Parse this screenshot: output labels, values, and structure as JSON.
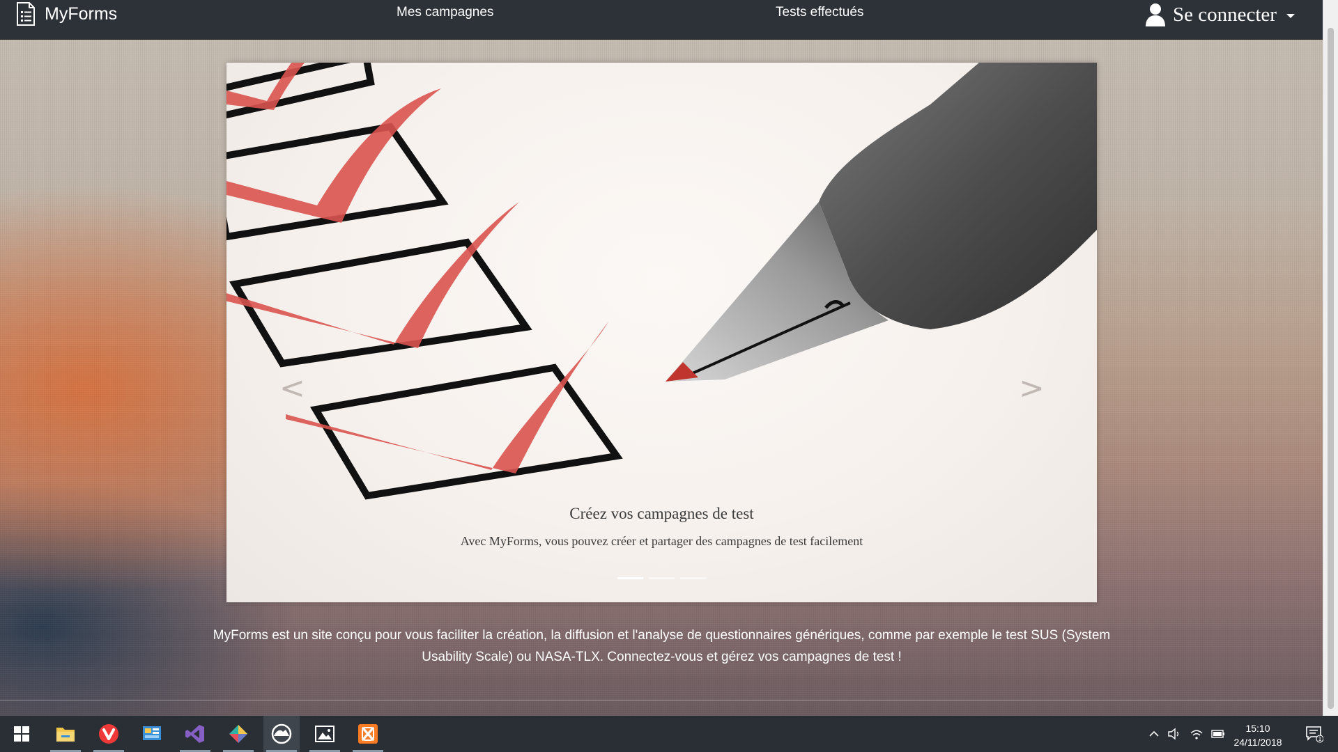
{
  "navbar": {
    "brand": "MyForms",
    "links": [
      "Mes campagnes",
      "Tests effectués"
    ],
    "login_label": "Se connecter"
  },
  "carousel": {
    "title": "Créez vos campagnes de test",
    "text": "Avec MyForms, vous pouvez créer et partager des campagnes de test facilement",
    "prev_glyph": "<",
    "next_glyph": ">",
    "slide_count": 3,
    "active_slide": 1
  },
  "description": "MyForms est un site conçu pour vous faciliter la création, la diffusion et l'analyse de questionnaires génériques, comme par exemple le test SUS (System Usability Scale) ou NASA-TLX. Connectez-vous et gérez vos campagnes de test !",
  "taskbar": {
    "apps": [
      "windows-start-icon",
      "file-explorer-icon",
      "vivaldi-icon",
      "control-panel-icon",
      "visual-studio-icon",
      "gitkraken-icon",
      "eclipse-icon",
      "photos-icon",
      "xampp-icon"
    ],
    "clock_time": "15:10",
    "clock_date": "24/11/2018",
    "notification_count": "1"
  },
  "colors": {
    "navbar_bg": "#2d3238",
    "taskbar_bg": "#2a2f35",
    "checkmark_red": "#d9534f",
    "vivaldi_red": "#ef3939",
    "visual_studio_purple": "#865fc5",
    "xampp_orange": "#fb7a24"
  }
}
